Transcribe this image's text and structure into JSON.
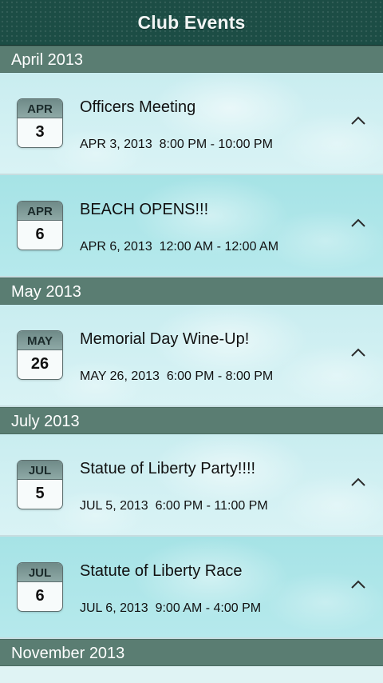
{
  "header": {
    "title": "Club Events"
  },
  "sections": [
    {
      "label": "April 2013",
      "events": [
        {
          "month": "APR",
          "day": "3",
          "title": "Officers Meeting",
          "datetime": "APR 3, 2013  8:00 PM - 10:00 PM"
        },
        {
          "month": "APR",
          "day": "6",
          "title": "BEACH OPENS!!!",
          "datetime": "APR 6, 2013  12:00 AM - 12:00 AM"
        }
      ]
    },
    {
      "label": "May 2013",
      "events": [
        {
          "month": "MAY",
          "day": "26",
          "title": "Memorial Day Wine-Up!",
          "datetime": "MAY 26, 2013  6:00 PM - 8:00 PM"
        }
      ]
    },
    {
      "label": "July 2013",
      "events": [
        {
          "month": "JUL",
          "day": "5",
          "title": "Statue of Liberty Party!!!!",
          "datetime": "JUL 5, 2013  6:00 PM - 11:00 PM"
        },
        {
          "month": "JUL",
          "day": "6",
          "title": "Statute of Liberty Race",
          "datetime": "JUL 6, 2013  9:00 AM - 4:00 PM"
        }
      ]
    },
    {
      "label": "November 2013",
      "events": []
    }
  ],
  "icons": {
    "row_action": "chevron-icon"
  }
}
